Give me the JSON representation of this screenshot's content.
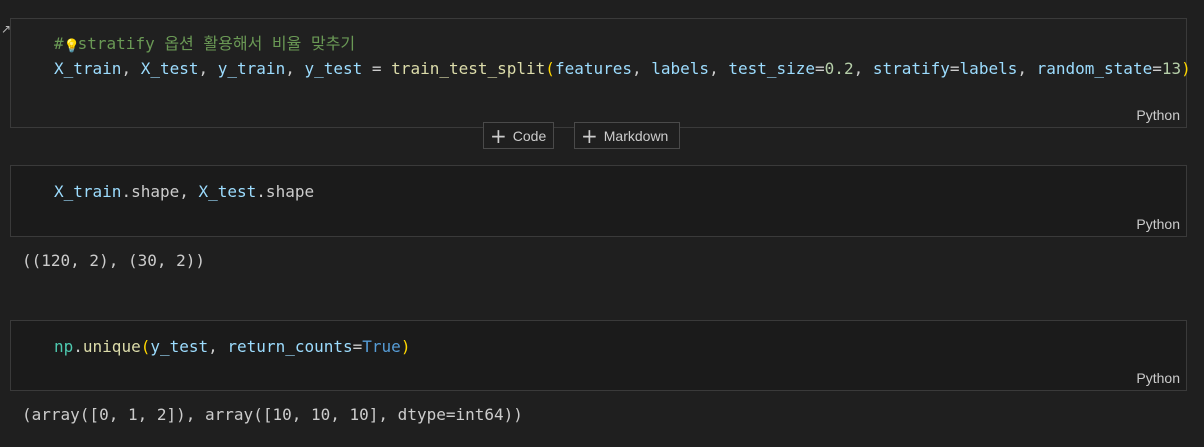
{
  "cells": [
    {
      "comment_prefix": "#",
      "comment_text": "stratify 옵션 활용해서 비율 맞추기",
      "line2": {
        "t1": "X_train",
        "s1": ", ",
        "t2": "X_test",
        "s2": ", ",
        "t3": "y_train",
        "s3": ", ",
        "t4": "y_test",
        "s4": " = ",
        "fn": "train_test_split",
        "po": "(",
        "a1": "features",
        "s5": ", ",
        "a2": "labels",
        "s6": ", ",
        "a3": "test_size",
        "eq1": "=",
        "n1": "0.2",
        "s7": ", ",
        "a4": "stratify",
        "eq2": "=",
        "a5": "labels",
        "s8": ", ",
        "a6": "random_state",
        "eq3": "=",
        "n2": "13",
        "pc": ")"
      },
      "language": "Python"
    },
    {
      "code": {
        "v1": "X_train",
        "d1": ".shape, ",
        "v2": "X_test",
        "d2": ".shape"
      },
      "language": "Python",
      "output": "((120, 2), (30, 2))"
    },
    {
      "code": {
        "mod": "np",
        "dot": ".",
        "fn": "unique",
        "po": "(",
        "v1": "y_test",
        "s1": ", ",
        "v2": "return_counts",
        "eq": "=",
        "kw": "True",
        "pc": ")"
      },
      "language": "Python",
      "output": "(array([0, 1, 2]), array([10, 10, 10], dtype=int64))"
    }
  ],
  "add_buttons": {
    "code_label": "Code",
    "markdown_label": "Markdown"
  },
  "colors": {
    "comment": "#6a9955",
    "variable": "#9cdcfe",
    "function": "#dcdcaa",
    "number": "#b5cea8",
    "keyword": "#569cd6"
  }
}
